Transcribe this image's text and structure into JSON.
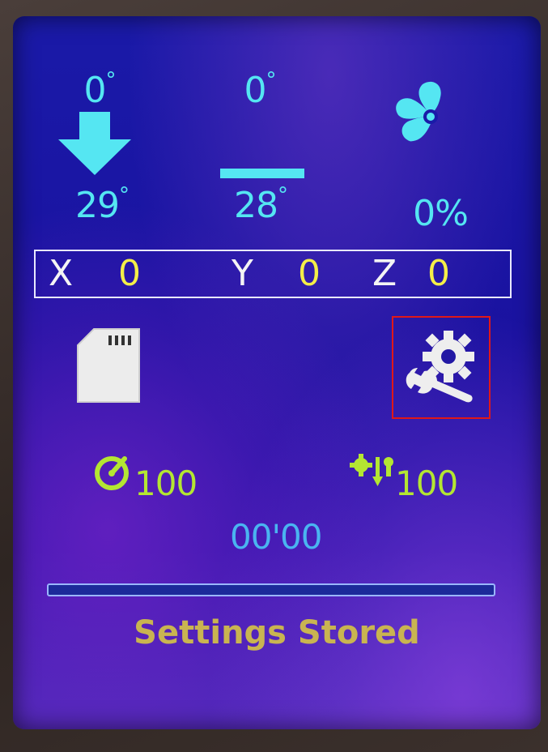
{
  "hotend": {
    "target": "0",
    "current": "29",
    "deg": "°"
  },
  "bed": {
    "target": "0",
    "current": "28",
    "deg": "°"
  },
  "fan": {
    "speed": "0%"
  },
  "axes": {
    "x_label": "X",
    "x_value": "0",
    "y_label": "Y",
    "y_value": "0",
    "z_label": "Z",
    "z_value": "0"
  },
  "stats": {
    "feedrate": "100",
    "flow": "100",
    "time": "00'00"
  },
  "progress": {
    "fraction": 0
  },
  "status_message": "Settings Stored",
  "icons": {
    "hotend": "arrow-down-icon",
    "bed": "bed-icon",
    "fan": "fan-icon",
    "sd": "sd-card-icon",
    "settings": "settings-wrench-gear-icon",
    "speed": "speed-gauge-icon",
    "flow": "flow-icon"
  },
  "colors": {
    "cyan": "#55e6f2",
    "yellow": "#f4ee48",
    "green": "#b4e632",
    "selection": "#e01818"
  }
}
